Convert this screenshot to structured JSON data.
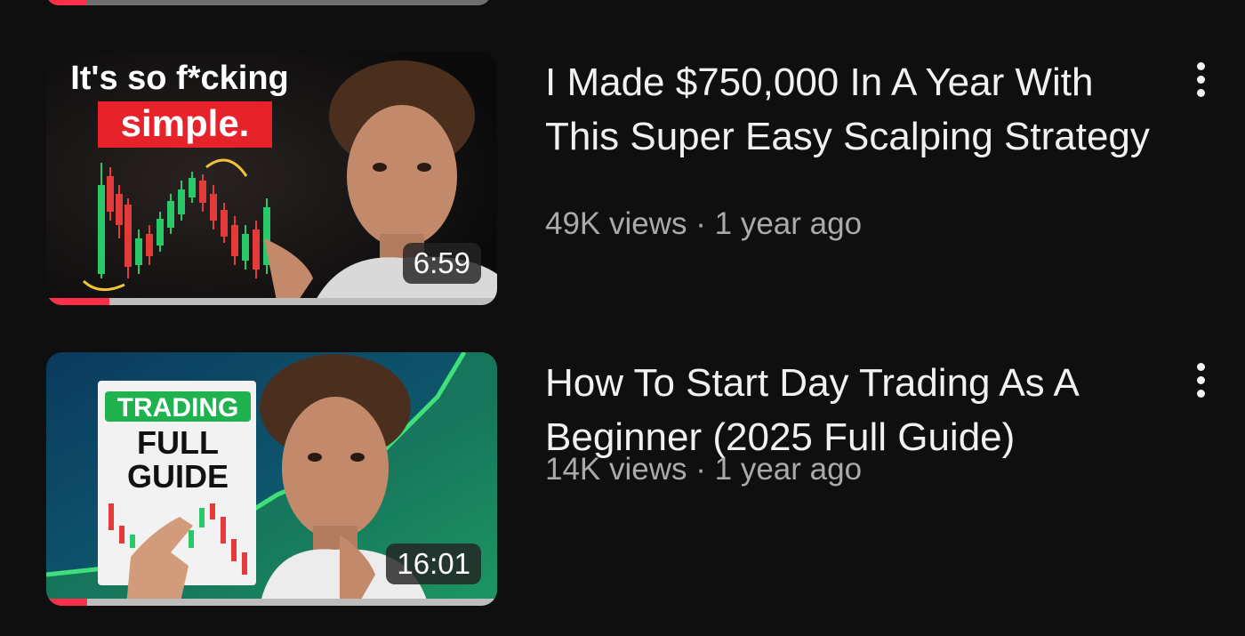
{
  "colors": {
    "background": "#0f0f0f",
    "progress_played": "#ff2f4a",
    "meta_text": "#aaaaaa"
  },
  "previous_video": {
    "progress": 0.09
  },
  "videos": [
    {
      "title": "I Made $750,000 In A Year With This Super Easy Scalping Strategy",
      "views": "49K views",
      "age": "1 year ago",
      "duration": "6:59",
      "watch_progress": 0.14,
      "thumbnail": {
        "line1": "It's so f*cking",
        "line2": "simple."
      },
      "menu_icon": "more-vert-icon"
    },
    {
      "title": "How To Start Day Trading As A Beginner (2025 Full Guide)",
      "views": "14K views",
      "age": "1 year ago",
      "duration": "16:01",
      "watch_progress": 0.09,
      "thumbnail": {
        "line1": "TRADING",
        "line2": "FULL",
        "line3": "GUIDE"
      },
      "menu_icon": "more-vert-icon"
    }
  ]
}
